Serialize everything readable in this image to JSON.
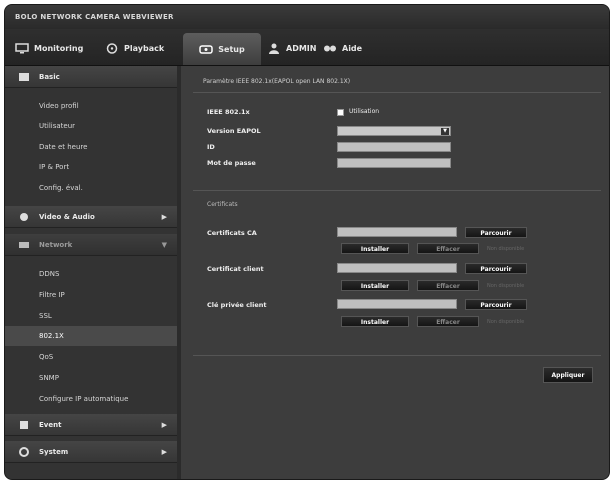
{
  "window": {
    "title": "BOLO NETWORK CAMERA WEBVIEWER"
  },
  "nav": {
    "monitoring": "Monitoring",
    "playback": "Playback",
    "setup": "Setup",
    "user": "ADMIN",
    "help": "Aide"
  },
  "sidebar": {
    "basic": "Basic",
    "basic_items": [
      "Video profil",
      "Utilisateur",
      "Date et heure",
      "IP & Port",
      "Config. éval."
    ],
    "video_audio": "Video & Audio",
    "network": "Network",
    "network_items": [
      "DDNS",
      "Filtre IP",
      "SSL",
      "802.1X",
      "QoS",
      "SNMP",
      "Configure IP automatique"
    ],
    "event": "Event",
    "system": "System"
  },
  "content": {
    "section_title": "Paramètre IEEE 802.1x(EAPOL open LAN 802.1X)",
    "ieee_label": "IEEE 802.1x",
    "use_label": "Utilisation",
    "eapol_label": "Version EAPOL",
    "id_label": "ID",
    "password_label": "Mot de passe",
    "certificates_title": "Certificats",
    "ca_label": "Certificats CA",
    "client_cert_label": "Certificat client",
    "client_key_label": "Clé privée client",
    "browse": "Parcourir",
    "install": "Installer",
    "remove": "Effacer",
    "status_ca": "Non disponible",
    "status_cert": "Non disponible",
    "status_key": "Non disponible",
    "apply": "Appliquer"
  },
  "colors": {
    "background": "#2b2b2b",
    "accent": "#5d5d5d"
  }
}
